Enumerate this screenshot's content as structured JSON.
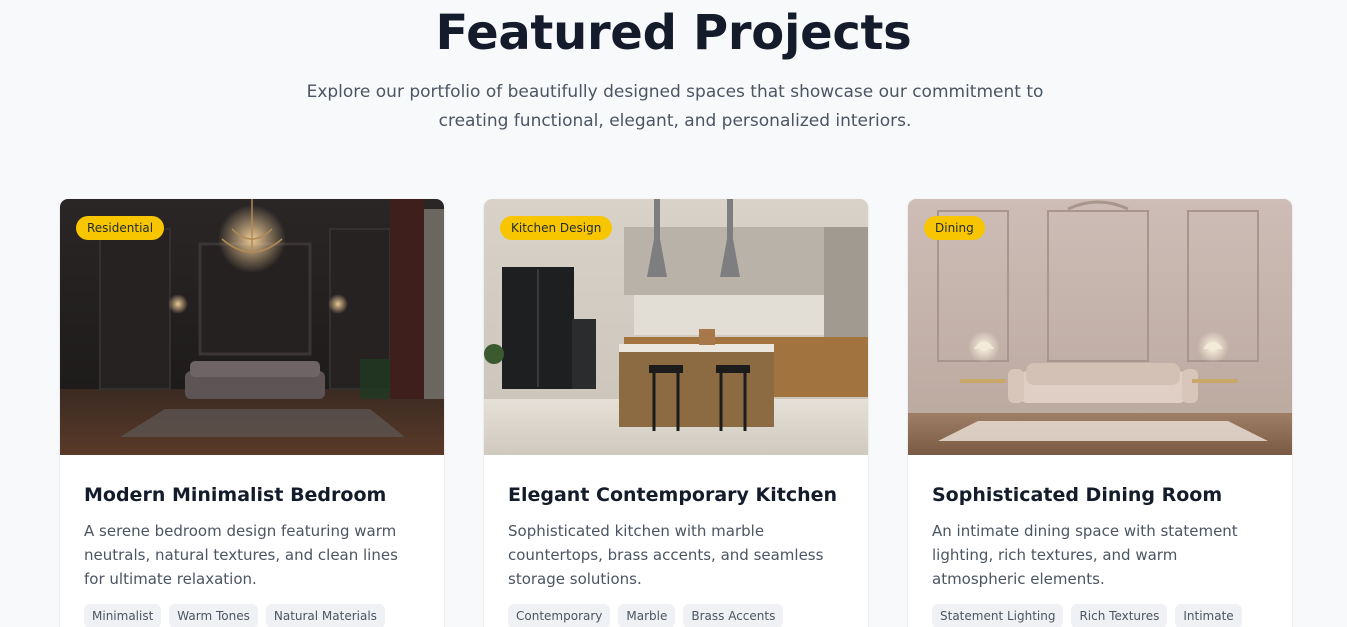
{
  "header": {
    "title": "Featured Projects",
    "subtitle": "Explore our portfolio of beautifully designed spaces that showcase our commitment to creating functional, elegant, and personalized interiors."
  },
  "colors": {
    "badge": "#f7c600",
    "heading": "#141b2b",
    "body_text": "#4b5563",
    "tag_bg": "#f0f1f4",
    "page_bg": "#f8f9fb"
  },
  "projects": [
    {
      "category": "Residential",
      "title": "Modern Minimalist Bedroom",
      "description": "A serene bedroom design featuring warm neutrals, natural textures, and clean lines for ultimate relaxation.",
      "tags": [
        "Minimalist",
        "Warm Tones",
        "Natural Materials"
      ]
    },
    {
      "category": "Kitchen Design",
      "title": "Elegant Contemporary Kitchen",
      "description": "Sophisticated kitchen with marble countertops, brass accents, and seamless storage solutions.",
      "tags": [
        "Contemporary",
        "Marble",
        "Brass Accents"
      ]
    },
    {
      "category": "Dining",
      "title": "Sophisticated Dining Room",
      "description": "An intimate dining space with statement lighting, rich textures, and warm atmospheric elements.",
      "tags": [
        "Statement Lighting",
        "Rich Textures",
        "Intimate"
      ]
    }
  ]
}
